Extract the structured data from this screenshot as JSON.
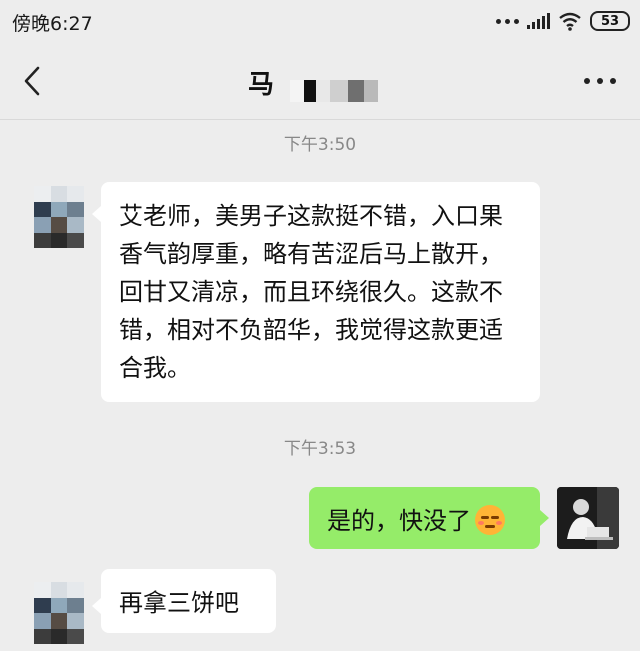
{
  "status_bar": {
    "time": "傍晚6:27",
    "battery": "53"
  },
  "header": {
    "title": "马",
    "back_icon": "chevron-left-icon",
    "more_icon": "more-dots-icon"
  },
  "messages": [
    {
      "type": "timestamp",
      "text": "下午3:50"
    },
    {
      "type": "incoming",
      "text": "艾老师，美男子这款挺不错，入口果香气韵厚重，略有苦涩后马上散开，回甘又清凉，而且环绕很久。这款不错，相对不负韶华，我觉得这款更适合我。"
    },
    {
      "type": "timestamp",
      "text": "下午3:53"
    },
    {
      "type": "outgoing",
      "text": "是的，快没了",
      "emoji": "smirk-emoji"
    },
    {
      "type": "incoming",
      "text": "再拿三饼吧"
    }
  ],
  "colors": {
    "background": "#ededed",
    "incoming_bubble": "#ffffff",
    "outgoing_bubble": "#95ec69",
    "timestamp_text": "#888888"
  }
}
